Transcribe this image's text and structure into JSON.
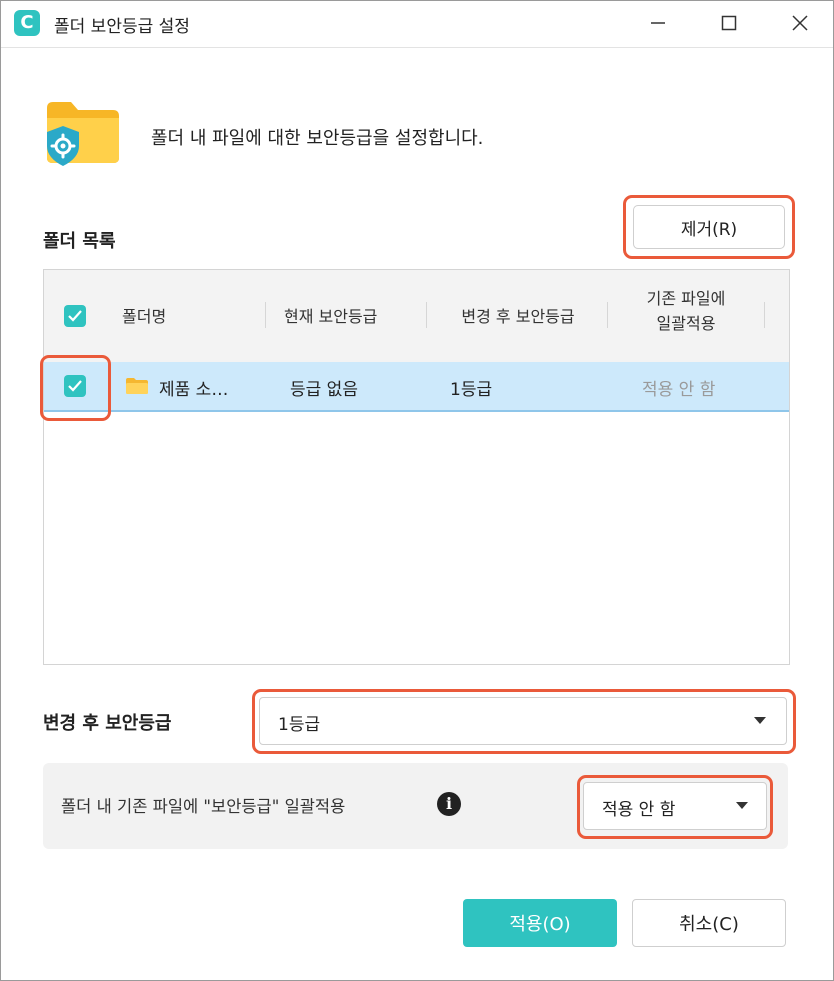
{
  "window": {
    "title": "폴더 보안등급 설정",
    "app_icon_letter": "C",
    "accent_color": "#2fc3c0",
    "highlight_color": "#ea5a3a"
  },
  "intro": {
    "text": "폴더 내 파일에 대한 보안등급을 설정합니다.",
    "icon": "folder-shield-gear-icon"
  },
  "folder_list": {
    "label": "폴더 목록",
    "remove_button": "제거(R)",
    "columns": [
      "폴더명",
      "현재 보안등급",
      "변경 후 보안등급",
      "기존 파일에",
      "일괄적용"
    ],
    "rows": [
      {
        "checked": true,
        "name": "제품 소…",
        "current_level": "등급 없음",
        "new_level": "1등급",
        "apply_existing": "적용 안 함"
      }
    ]
  },
  "new_level_field": {
    "label": "변경 후 보안등급",
    "value": "1등급"
  },
  "bulk_apply": {
    "label": "폴더 내 기존 파일에 \"보안등급\" 일괄적용",
    "value": "적용 안 함"
  },
  "footer": {
    "apply_button": "적용(O)",
    "cancel_button": "취소(C)"
  }
}
